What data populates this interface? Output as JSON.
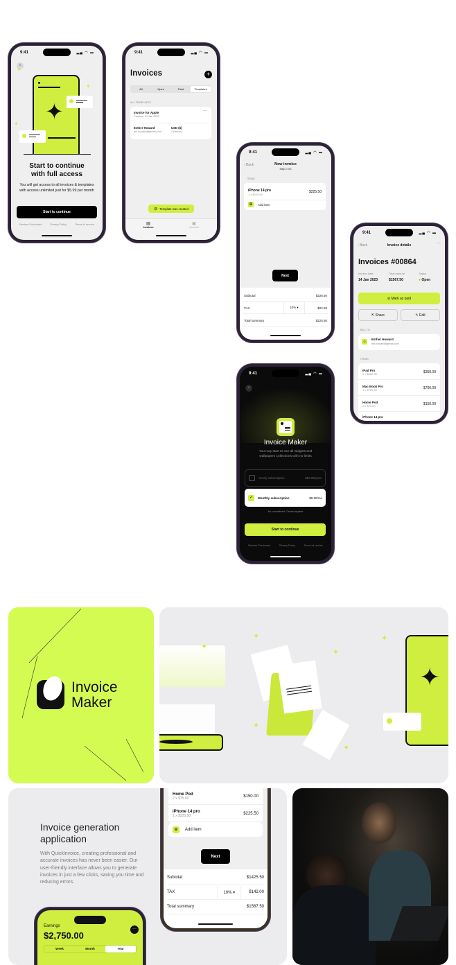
{
  "status_time": "9:41",
  "colors": {
    "accent": "#cfee3f",
    "dark": "#111111",
    "frame": "#2b2235",
    "surface": "#efeff0"
  },
  "paywall_light": {
    "title_line1": "Start to continue",
    "title_line2": "with full access",
    "body": "You will get access to all invoices & templates with access unlimited just for $5.99 per month",
    "cta": "Start to continue",
    "links": [
      "Restore Purchases",
      "Privacy Policy",
      "Terms of service"
    ]
  },
  "invoices_list": {
    "title": "Invoices",
    "tabs": [
      "All",
      "Open",
      "Paid",
      "Templates"
    ],
    "active_tab": "Templates",
    "section": "ALL TEMPLATES",
    "template": {
      "name": "Invoice for Apple",
      "created": "Created: 14 Jan 2023",
      "client": "Esther Howard",
      "email": "est.howard@gmail.com",
      "currency": "USD ($)",
      "currency_label": "Currency"
    },
    "toast": "Template was created",
    "tabbar": [
      "Invoices",
      "Account"
    ]
  },
  "new_invoice": {
    "back": "Back",
    "title": "New invoice",
    "step": "Step 2 of 3",
    "section": "ITEMS",
    "item": {
      "name": "iPhone 14 pro",
      "qty": "1 x $225.50",
      "price": "$225.50"
    },
    "add_item": "Add item",
    "next": "Next",
    "subtotal_label": "Subtotal",
    "subtotal": "$225.50",
    "tax_label": "TAX",
    "tax_rate": "10%",
    "tax": "$22.50",
    "total_label": "Total summary",
    "total": "$225.50"
  },
  "invoice_details": {
    "back": "Back",
    "title": "Invoice details",
    "number": "Invoices #00864",
    "date_label": "Invoice date",
    "date": "14 Jan 2023",
    "amount_label": "Total amount",
    "amount": "$1567.50",
    "status_label": "Status",
    "status": "Open",
    "mark_paid": "Mark as paid",
    "share": "Share",
    "edit": "Edit",
    "bill_to": "BILL TO",
    "client": "Esther Howard",
    "email": "est.howard@gmail.com",
    "items_label": "ITEMS",
    "items": [
      {
        "name": "iPad Pro",
        "qty": "1 x $350.00",
        "price": "$350.00"
      },
      {
        "name": "Mac Book Pro",
        "qty": "1 x $700.00",
        "price": "$700.00"
      },
      {
        "name": "Home Pod",
        "qty": "2 x $75.00",
        "price": "$150.00"
      },
      {
        "name": "iPhone 14 pro",
        "qty": "",
        "price": ""
      }
    ]
  },
  "paywall_dark": {
    "title": "Invoice Maker",
    "subtitle": "You may start to use all widgets and wallpapers collections with no limits",
    "yearly": "Yearly subscription",
    "yearly_price": "$59.99/year",
    "monthly": "Monthly subscription",
    "monthly_price": "$9.99/mo",
    "note": "No commitment. Cancel anytime",
    "cta": "Start to continue",
    "links": [
      "Restore Purchases",
      "Privacy Policy",
      "Terms of service"
    ]
  },
  "brand": {
    "line1": "Invoice",
    "line2": "Maker"
  },
  "promo": {
    "title": "Invoice generation application",
    "body": "With QuickInvoice, creating professional and accurate invoices has never been easier. Our user-friendly interface allows you to generate invoices in just a few clicks, saving you time and reducing errors."
  },
  "promo_phone": {
    "items": [
      {
        "name": "Home Pod",
        "qty": "2 x $75.00",
        "price": "$150.00"
      },
      {
        "name": "iPhone 14 pro",
        "qty": "1 x $225.50",
        "price": "$225.50"
      }
    ],
    "add_item": "Add item",
    "next": "Next",
    "subtotal_label": "Subtotal",
    "subtotal": "$1425.50",
    "tax_label": "TAX",
    "tax_rate": "10%",
    "tax": "$142.00",
    "total_label": "Total summary",
    "total": "$1567.50"
  },
  "earnings": {
    "label": "Earnings",
    "amount": "$2,750.00",
    "tabs": [
      "Week",
      "Month",
      "Year"
    ],
    "active_tab": "Year"
  }
}
